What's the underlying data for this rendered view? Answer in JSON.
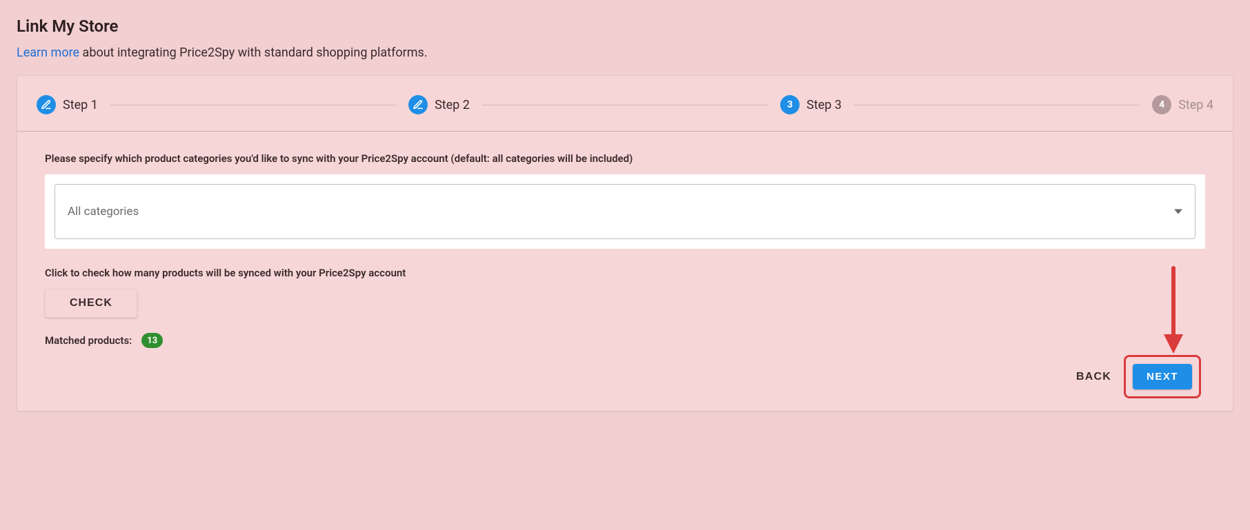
{
  "header": {
    "title": "Link My Store",
    "learn_more": "Learn more",
    "subtitle_rest": " about integrating Price2Spy with standard shopping platforms."
  },
  "stepper": {
    "steps": [
      {
        "label": "Step 1",
        "kind": "icon"
      },
      {
        "label": "Step 2",
        "kind": "icon"
      },
      {
        "label": "Step 3",
        "kind": "number",
        "number": "3"
      },
      {
        "label": "Step 4",
        "kind": "number",
        "number": "4"
      }
    ]
  },
  "body": {
    "instruction1": "Please specify which product categories you'd like to sync with your Price2Spy account (default: all categories will be included)",
    "select_value": "All categories",
    "instruction2": "Click to check how many products will be synced with your Price2Spy account",
    "check_label": "CHECK",
    "matched_label": "Matched products:",
    "matched_count": "13"
  },
  "actions": {
    "back": "BACK",
    "next": "NEXT"
  },
  "colors": {
    "accent_blue": "#1f8ee6",
    "accent_red": "#d93b3b",
    "badge_green": "#2f8f2f"
  }
}
